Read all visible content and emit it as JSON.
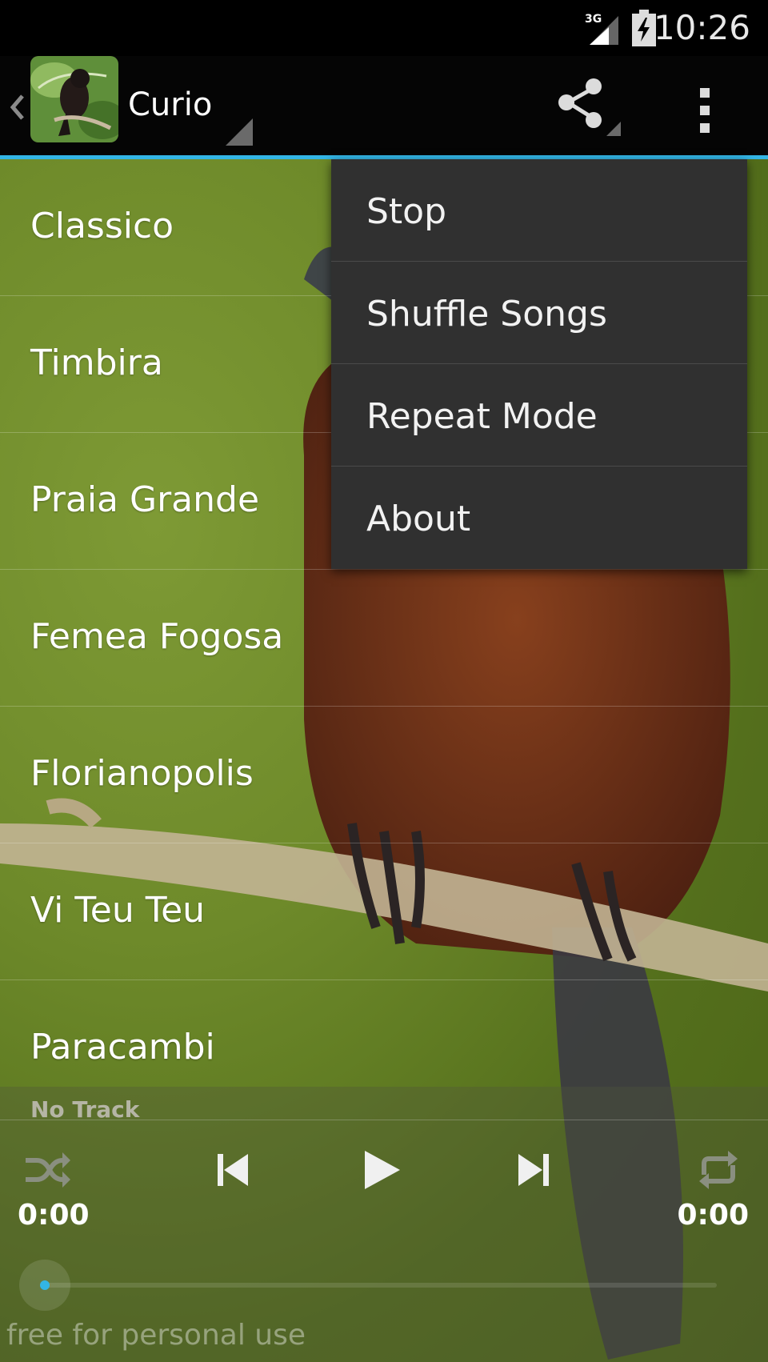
{
  "status_bar": {
    "network": "3G",
    "time": "10:26",
    "icons": [
      "signal-3g-icon",
      "battery-charging-icon"
    ]
  },
  "action_bar": {
    "title": "Curio",
    "icons": [
      "up-caret-icon",
      "app-bird-icon",
      "share-icon",
      "overflow-menu-icon"
    ],
    "accent_color": "#33b5e5"
  },
  "tracks": [
    {
      "label": "Classico"
    },
    {
      "label": "Timbira"
    },
    {
      "label": "Praia Grande"
    },
    {
      "label": "Femea Fogosa"
    },
    {
      "label": "Florianopolis"
    },
    {
      "label": "Vi Teu Teu"
    },
    {
      "label": "Paracambi"
    }
  ],
  "overflow_menu": {
    "items": [
      {
        "label": "Stop"
      },
      {
        "label": "Shuffle Songs"
      },
      {
        "label": "Repeat Mode"
      },
      {
        "label": "About"
      }
    ]
  },
  "player": {
    "now_playing": "No Track",
    "elapsed": "0:00",
    "duration": "0:00",
    "progress": 0,
    "controls": [
      "shuffle-icon",
      "previous-icon",
      "play-icon",
      "next-icon",
      "repeat-icon"
    ]
  },
  "footer": {
    "text": "free for personal use"
  }
}
